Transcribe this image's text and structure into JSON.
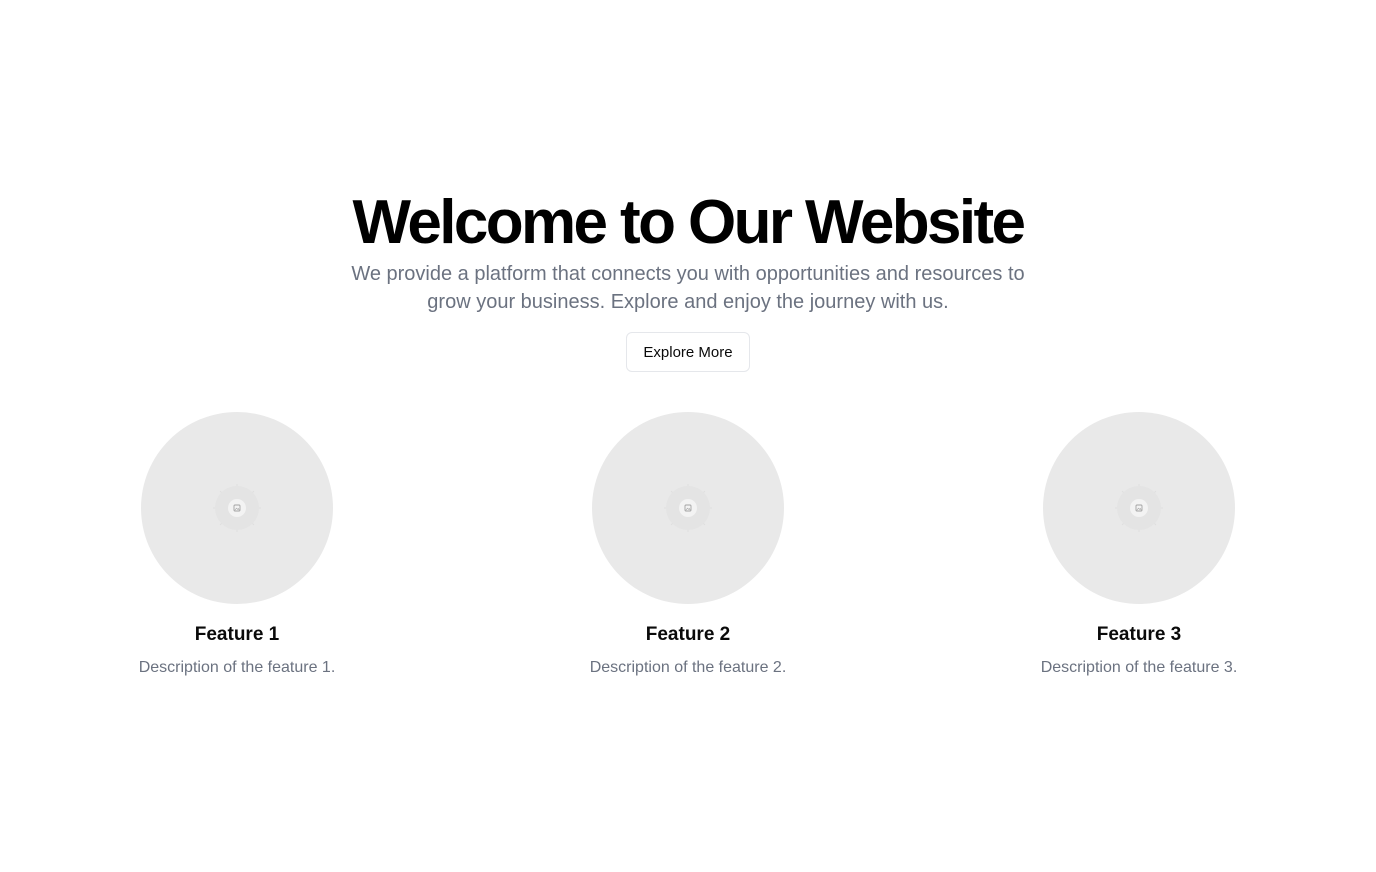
{
  "hero": {
    "title": "Welcome to Our Website",
    "subtitle": "We provide a platform that connects you with opportunities and resources to grow your business. Explore and enjoy the journey with us.",
    "button_label": "Explore More"
  },
  "features": [
    {
      "title": "Feature 1",
      "description": "Description of the feature 1.",
      "icon": "image-placeholder-icon"
    },
    {
      "title": "Feature 2",
      "description": "Description of the feature 2.",
      "icon": "image-placeholder-icon"
    },
    {
      "title": "Feature 3",
      "description": "Description of the feature 3.",
      "icon": "image-placeholder-icon"
    }
  ],
  "colors": {
    "heading": "#000000",
    "muted_text": "#6b7280",
    "placeholder_bg": "#e9e9e9",
    "button_border": "#e5e7eb"
  }
}
